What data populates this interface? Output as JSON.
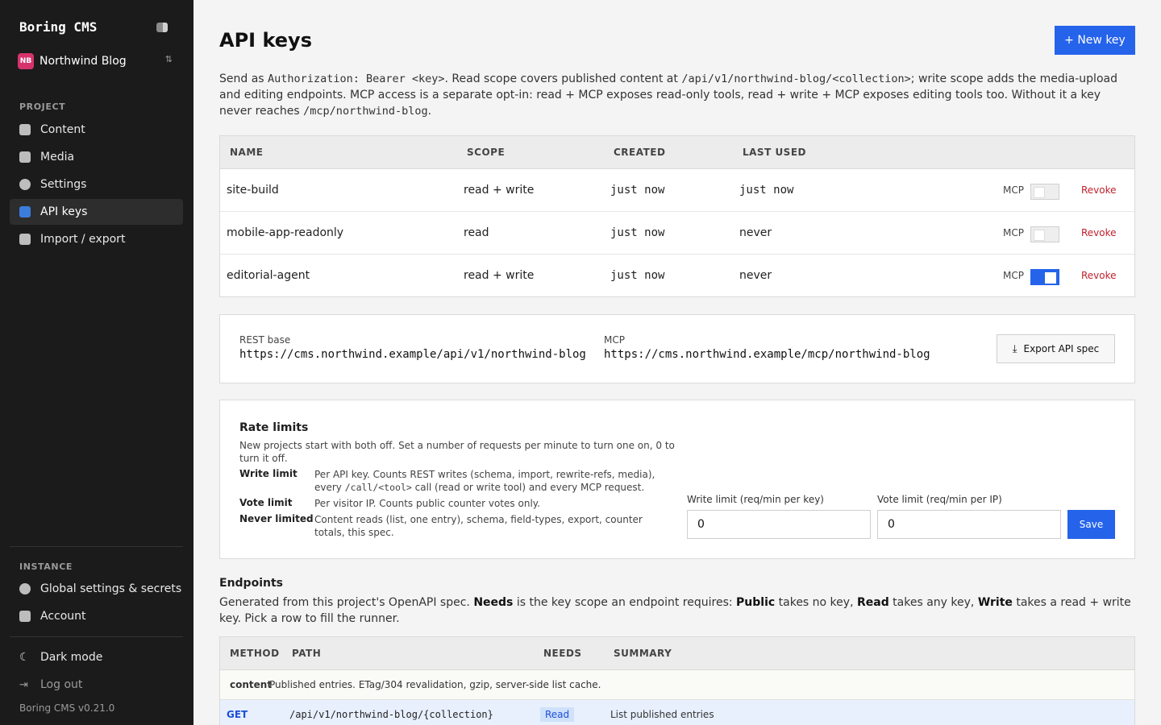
{
  "sidebar": {
    "brand": "Boring CMS",
    "project": {
      "initials": "NB",
      "name": "Northwind Blog"
    },
    "project_section": "PROJECT",
    "nav": [
      {
        "label": "Content",
        "icon": "book-icon"
      },
      {
        "label": "Media",
        "icon": "image-icon"
      },
      {
        "label": "Settings",
        "icon": "gear-icon"
      },
      {
        "label": "API keys",
        "icon": "key-icon",
        "active": true
      },
      {
        "label": "Import / export",
        "icon": "import-export-icon"
      }
    ],
    "instance_section": "INSTANCE",
    "instance_nav": [
      {
        "label": "Global settings & secrets",
        "icon": "gear-icon"
      },
      {
        "label": "Account",
        "icon": "account-icon"
      }
    ],
    "dark_mode": "Dark mode",
    "logout": "Log out",
    "version": "Boring CMS v0.21.0"
  },
  "header": {
    "title": "API keys",
    "new_key_label": "+ New key"
  },
  "intro": {
    "p1": "Send as ",
    "code1": "Authorization: Bearer <key>",
    "p2": ". Read scope covers published content at ",
    "code2": "/api/v1/northwind-blog/<collection>",
    "p3": "; write scope adds the media-upload and editing endpoints. MCP access is a separate opt-in: read + MCP exposes read-only tools, read + write + MCP exposes editing tools too. Without it a key never reaches ",
    "code3": "/mcp/northwind-blog",
    "p4": "."
  },
  "keys_table": {
    "headers": {
      "name": "NAME",
      "scope": "SCOPE",
      "created": "CREATED",
      "last_used": "LAST USED"
    },
    "mcp_label": "MCP",
    "revoke_label": "Revoke",
    "rows": [
      {
        "name": "site-build",
        "scope": "read + write",
        "created": "just now",
        "last_used": "just now",
        "mcp": false
      },
      {
        "name": "mobile-app-readonly",
        "scope": "read",
        "created": "just now",
        "last_used": "never",
        "mcp": false
      },
      {
        "name": "editorial-agent",
        "scope": "read + write",
        "created": "just now",
        "last_used": "never",
        "mcp": true
      }
    ]
  },
  "bases": {
    "rest_label": "REST base",
    "rest_url": "https://cms.northwind.example/api/v1/northwind-blog",
    "mcp_label": "MCP",
    "mcp_url": "https://cms.northwind.example/mcp/northwind-blog",
    "export_label": "Export API spec"
  },
  "rate_limits": {
    "title": "Rate limits",
    "description": "New projects start with both off. Set a number of requests per minute to turn one on, 0 to turn it off.",
    "write_key": "Write limit",
    "write_desc_1": "Per API key. Counts REST writes (schema, import, rewrite-refs, media), every ",
    "write_desc_code": "/call/<tool>",
    "write_desc_2": " call (read or write tool) and every MCP request.",
    "vote_key": "Vote limit",
    "vote_desc": "Per visitor IP. Counts public counter votes only.",
    "never_key": "Never limited",
    "never_desc": "Content reads (list, one entry), schema, field-types, export, counter totals, this spec.",
    "write_field_label": "Write limit (req/min per key)",
    "write_field_value": "0",
    "vote_field_label": "Vote limit (req/min per IP)",
    "vote_field_value": "0",
    "save_label": "Save"
  },
  "endpoints": {
    "title": "Endpoints",
    "d1": "Generated from this project's OpenAPI spec. ",
    "b1": "Needs",
    "d2": " is the key scope an endpoint requires: ",
    "b2": "Public",
    "d3": " takes no key, ",
    "b3": "Read",
    "d4": " takes any key, ",
    "b4": "Write",
    "d5": " takes a read + write key. Pick a row to fill the runner.",
    "headers": {
      "method": "METHOD",
      "path": "PATH",
      "needs": "NEEDS",
      "summary": "SUMMARY"
    },
    "group": {
      "name": "content",
      "desc": "Published entries. ETag/304 revalidation, gzip, server-side list cache."
    },
    "rows": [
      {
        "method": "GET",
        "path": "/api/v1/northwind-blog/{collection}",
        "needs": "Read",
        "summary": "List published entries"
      }
    ]
  },
  "colors": {
    "accent": "#2563eb",
    "danger": "#c0202c",
    "sidebar_bg": "#1b1b1b"
  }
}
